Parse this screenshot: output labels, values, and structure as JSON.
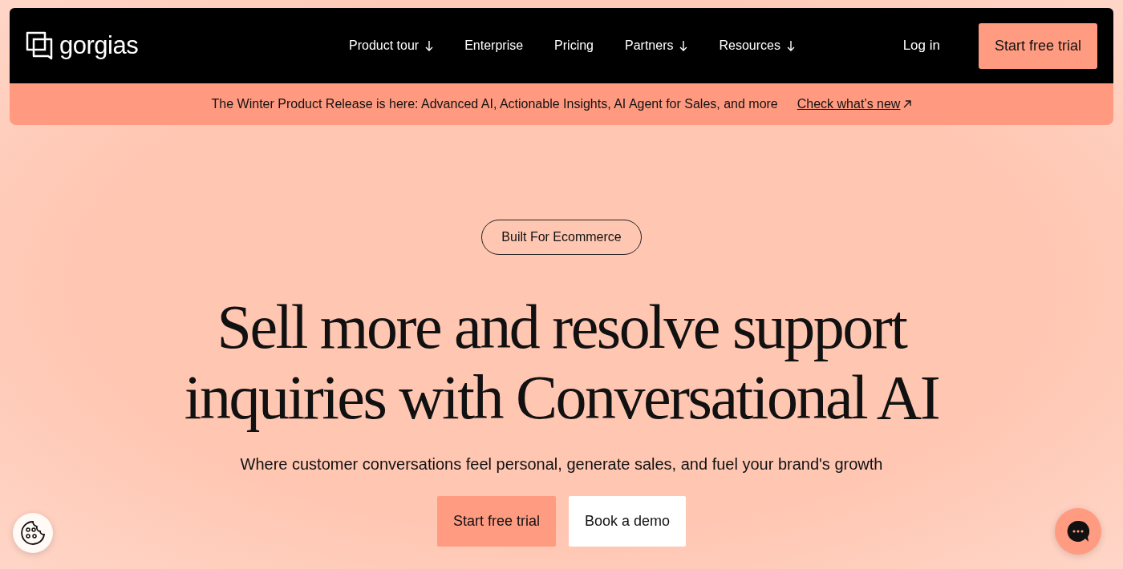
{
  "navbar": {
    "logo": "gorgias",
    "links": [
      {
        "label": "Product tour",
        "has_menu": true
      },
      {
        "label": "Enterprise",
        "has_menu": false
      },
      {
        "label": "Pricing",
        "has_menu": false
      },
      {
        "label": "Partners",
        "has_menu": true
      },
      {
        "label": "Resources",
        "has_menu": true
      }
    ],
    "login": "Log in",
    "cta": "Start free trial"
  },
  "announcement": {
    "text": "The Winter Product Release is here: Advanced AI, Actionable Insights, AI Agent for Sales, and more",
    "link": "Check what’s new"
  },
  "hero": {
    "badge": "Built For Ecommerce",
    "title": "Sell more and resolve support inquiries with Conversational AI",
    "subtitle": "Where customer conversations feel personal, generate sales, and fuel your brand's growth",
    "buttons": [
      {
        "label": "Start free trial",
        "kind": "primary"
      },
      {
        "label": "Book a demo",
        "kind": "secondary"
      }
    ]
  }
}
